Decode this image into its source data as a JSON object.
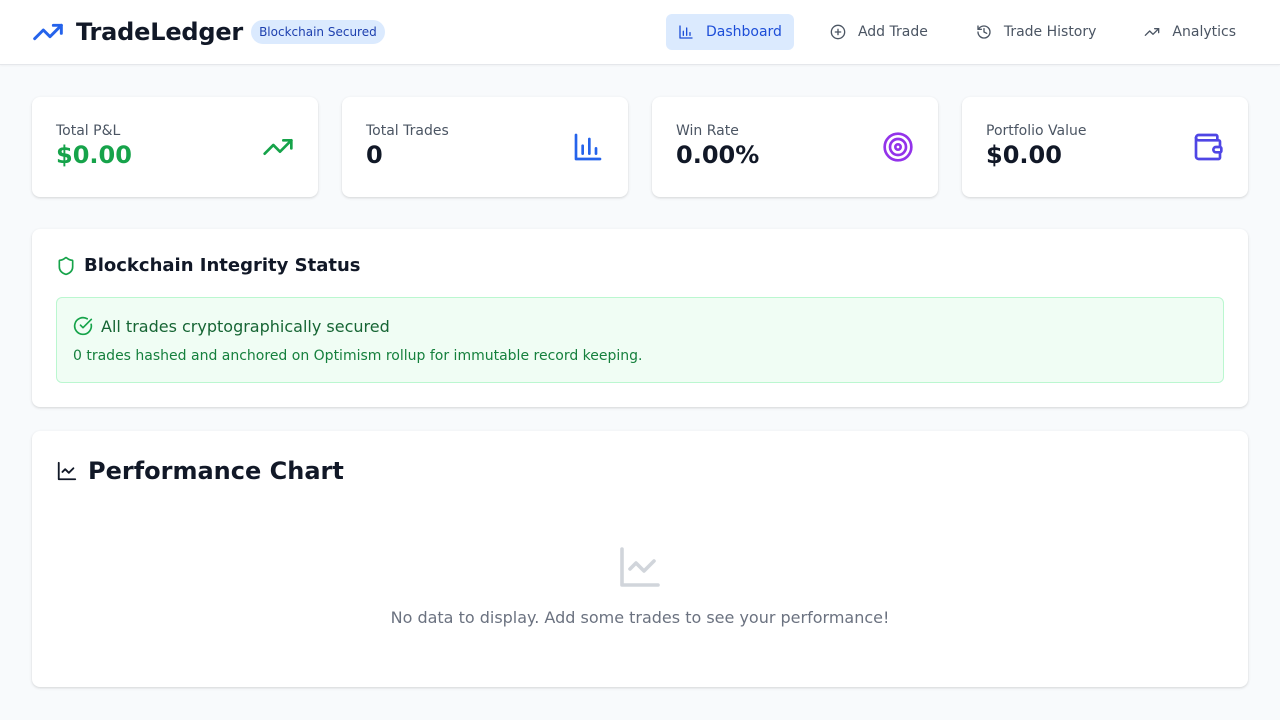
{
  "header": {
    "title": "TradeLedger",
    "badge": "Blockchain Secured",
    "nav": [
      {
        "label": "Dashboard",
        "icon": "bar-chart-icon",
        "active": true
      },
      {
        "label": "Add Trade",
        "icon": "plus-circle-icon",
        "active": false
      },
      {
        "label": "Trade History",
        "icon": "history-icon",
        "active": false
      },
      {
        "label": "Analytics",
        "icon": "trending-up-icon",
        "active": false
      }
    ]
  },
  "stats": [
    {
      "label": "Total P&L",
      "value": "$0.00",
      "icon": "trending-up-icon",
      "color": "#16a34a"
    },
    {
      "label": "Total Trades",
      "value": "0",
      "icon": "bar-chart-icon",
      "color": "#2563eb"
    },
    {
      "label": "Win Rate",
      "value": "0.00%",
      "icon": "target-icon",
      "color": "#9333ea"
    },
    {
      "label": "Portfolio Value",
      "value": "$0.00",
      "icon": "wallet-icon",
      "color": "#4f46e5"
    }
  ],
  "integrity": {
    "title": "Blockchain Integrity Status",
    "status_title": "All trades cryptographically secured",
    "status_desc": "0 trades hashed and anchored on Optimism rollup for immutable record keeping."
  },
  "performance": {
    "title": "Performance Chart",
    "empty_message": "No data to display. Add some trades to see your performance!"
  },
  "colors": {
    "accent": "#2563eb",
    "success": "#16a34a",
    "purple": "#9333ea",
    "indigo": "#4f46e5"
  }
}
